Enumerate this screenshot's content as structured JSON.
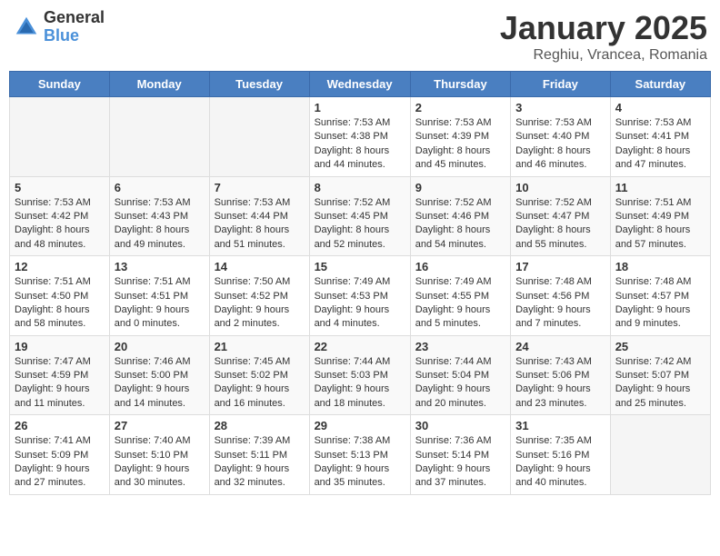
{
  "header": {
    "logo_general": "General",
    "logo_blue": "Blue",
    "title": "January 2025",
    "location": "Reghiu, Vrancea, Romania"
  },
  "weekdays": [
    "Sunday",
    "Monday",
    "Tuesday",
    "Wednesday",
    "Thursday",
    "Friday",
    "Saturday"
  ],
  "weeks": [
    [
      {
        "day": "",
        "info": ""
      },
      {
        "day": "",
        "info": ""
      },
      {
        "day": "",
        "info": ""
      },
      {
        "day": "1",
        "info": "Sunrise: 7:53 AM\nSunset: 4:38 PM\nDaylight: 8 hours\nand 44 minutes."
      },
      {
        "day": "2",
        "info": "Sunrise: 7:53 AM\nSunset: 4:39 PM\nDaylight: 8 hours\nand 45 minutes."
      },
      {
        "day": "3",
        "info": "Sunrise: 7:53 AM\nSunset: 4:40 PM\nDaylight: 8 hours\nand 46 minutes."
      },
      {
        "day": "4",
        "info": "Sunrise: 7:53 AM\nSunset: 4:41 PM\nDaylight: 8 hours\nand 47 minutes."
      }
    ],
    [
      {
        "day": "5",
        "info": "Sunrise: 7:53 AM\nSunset: 4:42 PM\nDaylight: 8 hours\nand 48 minutes."
      },
      {
        "day": "6",
        "info": "Sunrise: 7:53 AM\nSunset: 4:43 PM\nDaylight: 8 hours\nand 49 minutes."
      },
      {
        "day": "7",
        "info": "Sunrise: 7:53 AM\nSunset: 4:44 PM\nDaylight: 8 hours\nand 51 minutes."
      },
      {
        "day": "8",
        "info": "Sunrise: 7:52 AM\nSunset: 4:45 PM\nDaylight: 8 hours\nand 52 minutes."
      },
      {
        "day": "9",
        "info": "Sunrise: 7:52 AM\nSunset: 4:46 PM\nDaylight: 8 hours\nand 54 minutes."
      },
      {
        "day": "10",
        "info": "Sunrise: 7:52 AM\nSunset: 4:47 PM\nDaylight: 8 hours\nand 55 minutes."
      },
      {
        "day": "11",
        "info": "Sunrise: 7:51 AM\nSunset: 4:49 PM\nDaylight: 8 hours\nand 57 minutes."
      }
    ],
    [
      {
        "day": "12",
        "info": "Sunrise: 7:51 AM\nSunset: 4:50 PM\nDaylight: 8 hours\nand 58 minutes."
      },
      {
        "day": "13",
        "info": "Sunrise: 7:51 AM\nSunset: 4:51 PM\nDaylight: 9 hours\nand 0 minutes."
      },
      {
        "day": "14",
        "info": "Sunrise: 7:50 AM\nSunset: 4:52 PM\nDaylight: 9 hours\nand 2 minutes."
      },
      {
        "day": "15",
        "info": "Sunrise: 7:49 AM\nSunset: 4:53 PM\nDaylight: 9 hours\nand 4 minutes."
      },
      {
        "day": "16",
        "info": "Sunrise: 7:49 AM\nSunset: 4:55 PM\nDaylight: 9 hours\nand 5 minutes."
      },
      {
        "day": "17",
        "info": "Sunrise: 7:48 AM\nSunset: 4:56 PM\nDaylight: 9 hours\nand 7 minutes."
      },
      {
        "day": "18",
        "info": "Sunrise: 7:48 AM\nSunset: 4:57 PM\nDaylight: 9 hours\nand 9 minutes."
      }
    ],
    [
      {
        "day": "19",
        "info": "Sunrise: 7:47 AM\nSunset: 4:59 PM\nDaylight: 9 hours\nand 11 minutes."
      },
      {
        "day": "20",
        "info": "Sunrise: 7:46 AM\nSunset: 5:00 PM\nDaylight: 9 hours\nand 14 minutes."
      },
      {
        "day": "21",
        "info": "Sunrise: 7:45 AM\nSunset: 5:02 PM\nDaylight: 9 hours\nand 16 minutes."
      },
      {
        "day": "22",
        "info": "Sunrise: 7:44 AM\nSunset: 5:03 PM\nDaylight: 9 hours\nand 18 minutes."
      },
      {
        "day": "23",
        "info": "Sunrise: 7:44 AM\nSunset: 5:04 PM\nDaylight: 9 hours\nand 20 minutes."
      },
      {
        "day": "24",
        "info": "Sunrise: 7:43 AM\nSunset: 5:06 PM\nDaylight: 9 hours\nand 23 minutes."
      },
      {
        "day": "25",
        "info": "Sunrise: 7:42 AM\nSunset: 5:07 PM\nDaylight: 9 hours\nand 25 minutes."
      }
    ],
    [
      {
        "day": "26",
        "info": "Sunrise: 7:41 AM\nSunset: 5:09 PM\nDaylight: 9 hours\nand 27 minutes."
      },
      {
        "day": "27",
        "info": "Sunrise: 7:40 AM\nSunset: 5:10 PM\nDaylight: 9 hours\nand 30 minutes."
      },
      {
        "day": "28",
        "info": "Sunrise: 7:39 AM\nSunset: 5:11 PM\nDaylight: 9 hours\nand 32 minutes."
      },
      {
        "day": "29",
        "info": "Sunrise: 7:38 AM\nSunset: 5:13 PM\nDaylight: 9 hours\nand 35 minutes."
      },
      {
        "day": "30",
        "info": "Sunrise: 7:36 AM\nSunset: 5:14 PM\nDaylight: 9 hours\nand 37 minutes."
      },
      {
        "day": "31",
        "info": "Sunrise: 7:35 AM\nSunset: 5:16 PM\nDaylight: 9 hours\nand 40 minutes."
      },
      {
        "day": "",
        "info": ""
      }
    ]
  ]
}
